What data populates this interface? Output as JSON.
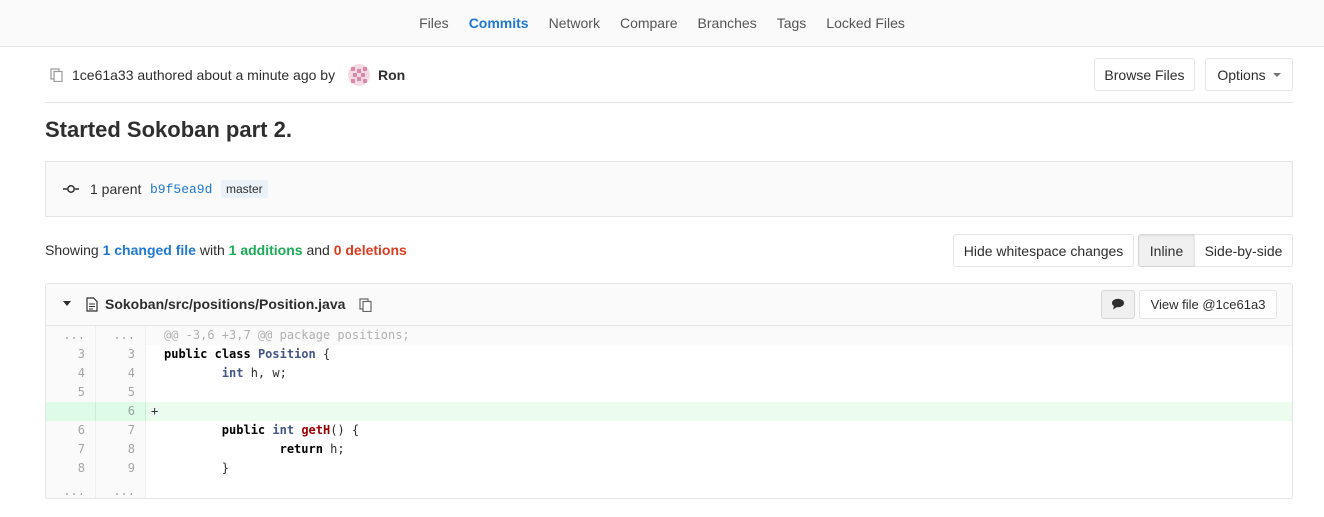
{
  "nav": {
    "items": [
      {
        "label": "Files",
        "active": false
      },
      {
        "label": "Commits",
        "active": true
      },
      {
        "label": "Network",
        "active": false
      },
      {
        "label": "Compare",
        "active": false
      },
      {
        "label": "Branches",
        "active": false
      },
      {
        "label": "Tags",
        "active": false
      },
      {
        "label": "Locked Files",
        "active": false
      }
    ]
  },
  "commit": {
    "meta": "1ce61a33 authored about a minute ago by",
    "author": "Ron",
    "browse_label": "Browse Files",
    "options_label": "Options",
    "title": "Started Sokoban part 2.",
    "parent_text": "1 parent",
    "parent_sha": "b9f5ea9d",
    "branch": "master"
  },
  "stats": {
    "showing": "Showing",
    "changed": "1 changed file",
    "with": "with",
    "additions": "1 additions",
    "and": "and",
    "deletions": "0 deletions",
    "whitespace_label": "Hide whitespace changes",
    "inline_label": "Inline",
    "side_label": "Side-by-side"
  },
  "file": {
    "path": "Sokoban/src/positions/Position.java",
    "view_label": "View file @1ce61a3",
    "lines": [
      {
        "type": "match",
        "old": "...",
        "new": "...",
        "text": "@@ -3,6 +3,7 @@ package positions;"
      },
      {
        "type": "context",
        "old": "3",
        "new": "3",
        "tokens": [
          [
            "kw",
            "public"
          ],
          [
            "t",
            " "
          ],
          [
            "kw",
            "class"
          ],
          [
            "t",
            " "
          ],
          [
            "nc",
            "Position"
          ],
          [
            "t",
            " {"
          ]
        ]
      },
      {
        "type": "context",
        "old": "4",
        "new": "4",
        "tokens": [
          [
            "t",
            "        "
          ],
          [
            "kt",
            "int"
          ],
          [
            "t",
            " h, w;"
          ]
        ]
      },
      {
        "type": "context",
        "old": "5",
        "new": "5",
        "tokens": [
          [
            "t",
            ""
          ]
        ]
      },
      {
        "type": "new",
        "old": "",
        "new": "6",
        "tokens": [
          [
            "t",
            "+"
          ]
        ]
      },
      {
        "type": "context",
        "old": "6",
        "new": "7",
        "tokens": [
          [
            "t",
            "        "
          ],
          [
            "kw",
            "public"
          ],
          [
            "t",
            " "
          ],
          [
            "kt",
            "int"
          ],
          [
            "t",
            " "
          ],
          [
            "nf",
            "getH"
          ],
          [
            "t",
            "() {"
          ]
        ]
      },
      {
        "type": "context",
        "old": "7",
        "new": "8",
        "tokens": [
          [
            "t",
            "                "
          ],
          [
            "kw",
            "return"
          ],
          [
            "t",
            " h;"
          ]
        ]
      },
      {
        "type": "context",
        "old": "8",
        "new": "9",
        "tokens": [
          [
            "t",
            "        }"
          ]
        ]
      },
      {
        "type": "end",
        "old": "...",
        "new": "...",
        "tokens": [
          [
            "t",
            ""
          ]
        ]
      }
    ]
  },
  "colors": {
    "accent": "#1f78d1",
    "addition": "#1aaa55",
    "deletion": "#db3b21",
    "new_line_bg": "#ecfdf0"
  },
  "icons": {
    "copy": "clipboard-icon",
    "commit": "commit-node-icon",
    "file": "file-text-icon",
    "comment": "speech-bubble-icon"
  }
}
